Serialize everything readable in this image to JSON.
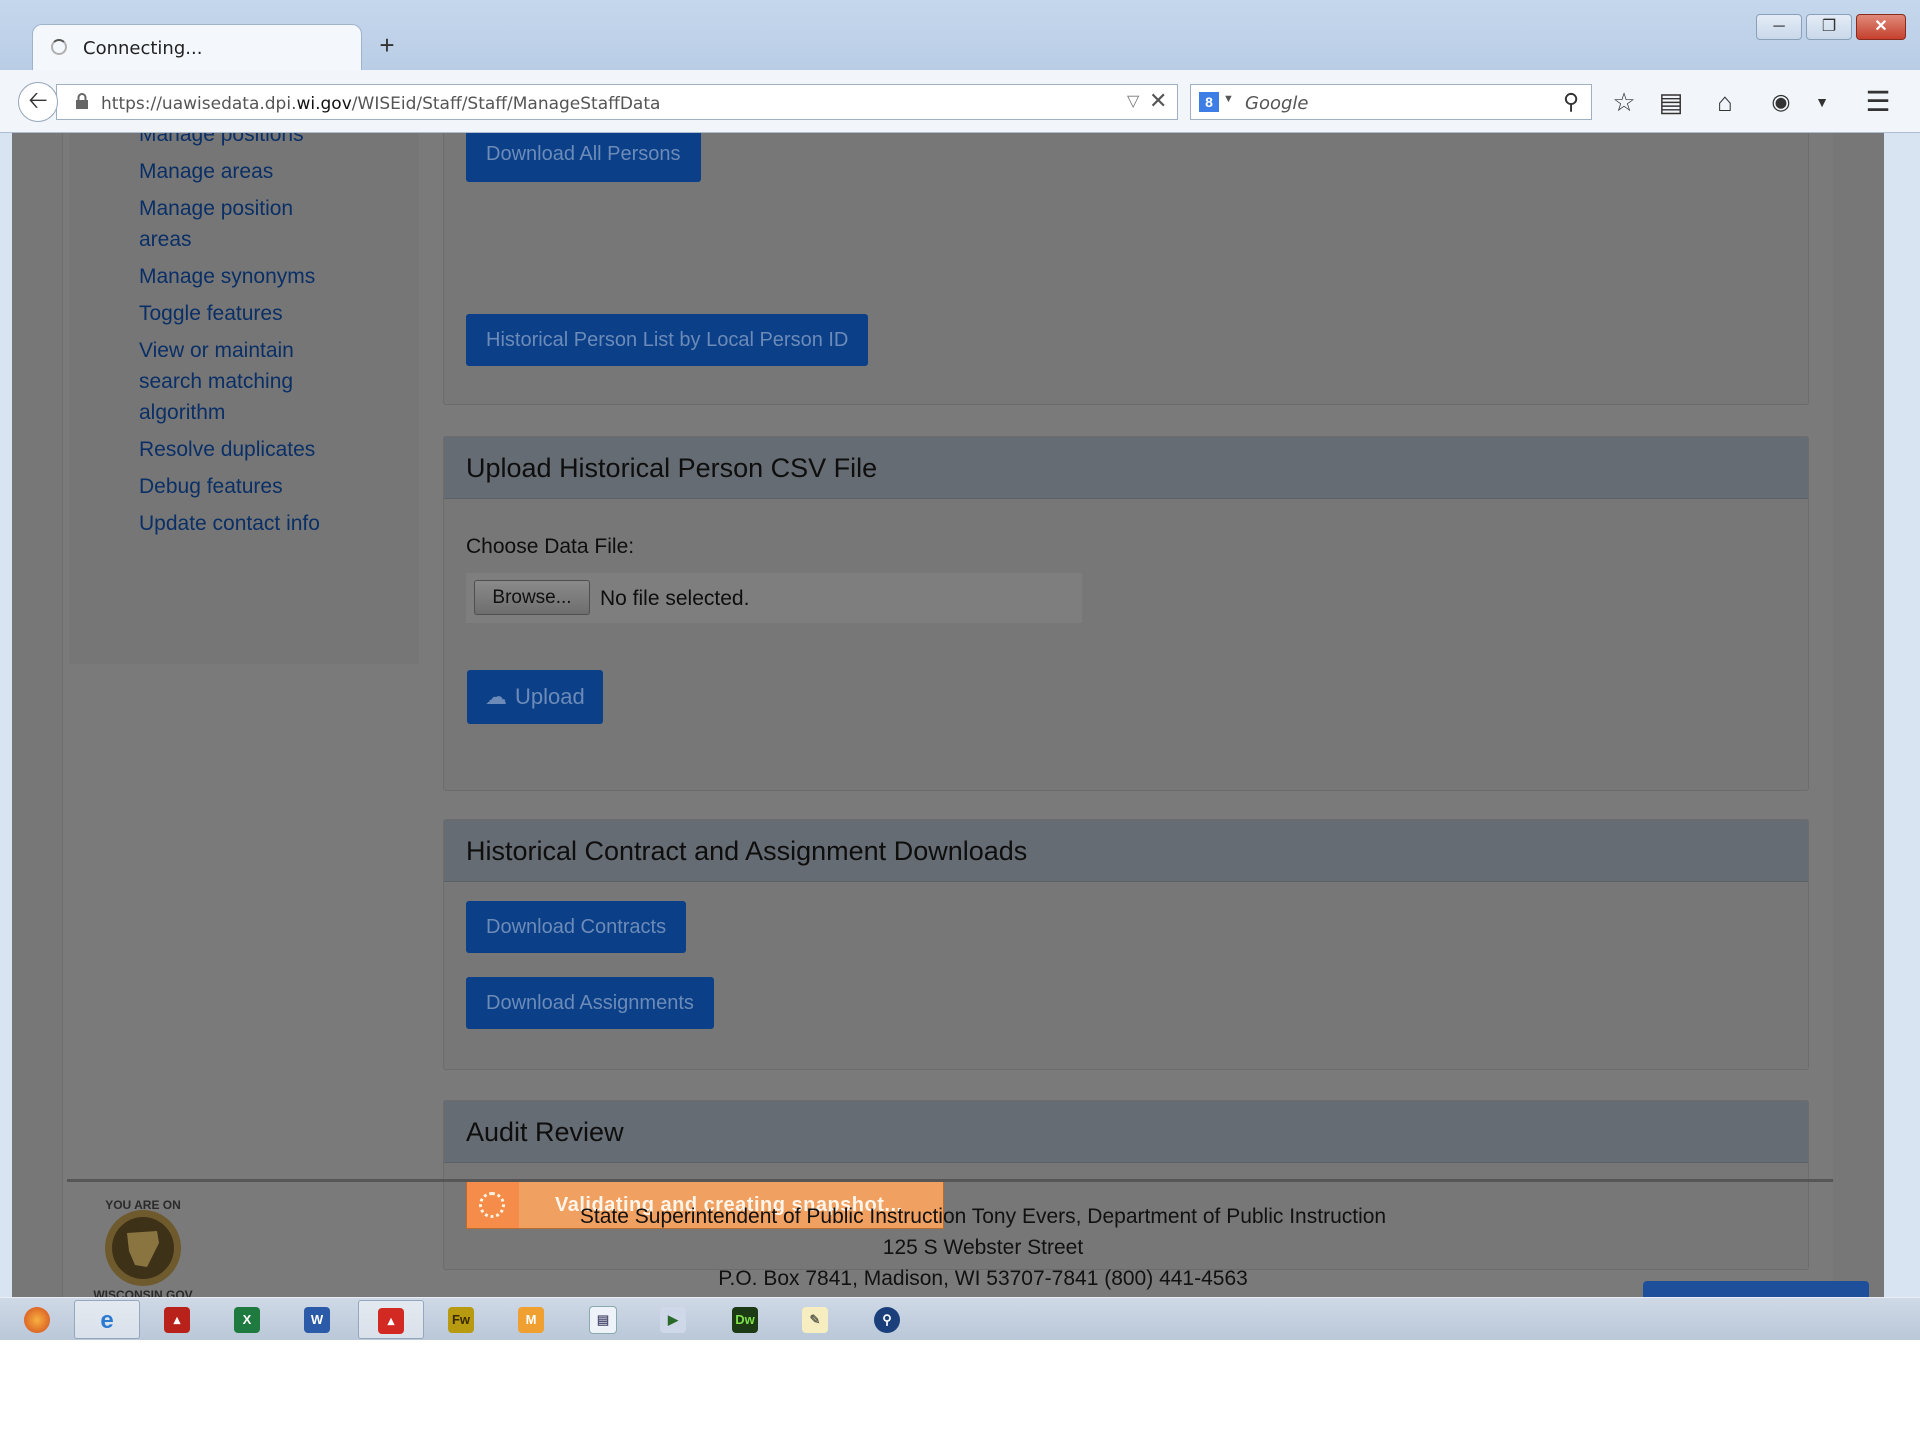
{
  "browser": {
    "tab_title": "Connecting...",
    "new_tab": "+",
    "url_prefix": "https://uawisedata.dpi.",
    "url_domain": "wi.gov",
    "url_path": "/WISEid/Staff/Staff/ManageStaffData",
    "search_engine_letter": "8",
    "search_placeholder": "Google"
  },
  "sidebar": {
    "items": [
      {
        "label": "Manage positions"
      },
      {
        "label": "Manage areas"
      },
      {
        "label": "Manage position"
      },
      {
        "label": "areas"
      },
      {
        "label": "Manage synonyms"
      },
      {
        "label": "Toggle features"
      },
      {
        "label": "View or maintain"
      },
      {
        "label": "search matching"
      },
      {
        "label": "algorithm"
      },
      {
        "label": "Resolve duplicates"
      },
      {
        "label": "Debug features"
      },
      {
        "label": "Update contact info"
      }
    ]
  },
  "downloads_panel": {
    "download_all_label": "Download All Persons",
    "historical_list_label": "Historical Person List by Local Person ID"
  },
  "upload_panel": {
    "title": "Upload Historical Person CSV File",
    "field_label": "Choose Data File:",
    "browse_label": "Browse...",
    "file_status": "No file selected.",
    "upload_label": "Upload"
  },
  "contract_panel": {
    "title": "Historical Contract and Assignment Downloads",
    "download_contracts_label": "Download Contracts",
    "download_assignments_label": "Download Assignments"
  },
  "audit_panel": {
    "title": "Audit Review",
    "status_message": "Validating and creating snapshot..."
  },
  "footer": {
    "line1": "State Superintendent of Public Instruction Tony Evers, Department of Public Instruction",
    "line2": "125 S Webster Street",
    "line3": "P.O. Box 7841, Madison, WI 53707-7841 (800) 441-4563",
    "seal_text": "YOU ARE ON WISCONSIN.GOV"
  },
  "taskbar": {
    "apps": [
      "firefox",
      "internet-explorer",
      "acrobat",
      "excel",
      "word",
      "acrobat-pro",
      "fireworks",
      "mail",
      "notepad-doc",
      "installer",
      "dreamweaver",
      "notes",
      "search-app"
    ],
    "labels": {
      "fireworks": "Fw",
      "dreamweaver": "Dw"
    }
  },
  "colors": {
    "button_blue": "#0b3f87",
    "status_orange": "#f0a060",
    "overlay_gray": "#777777"
  }
}
